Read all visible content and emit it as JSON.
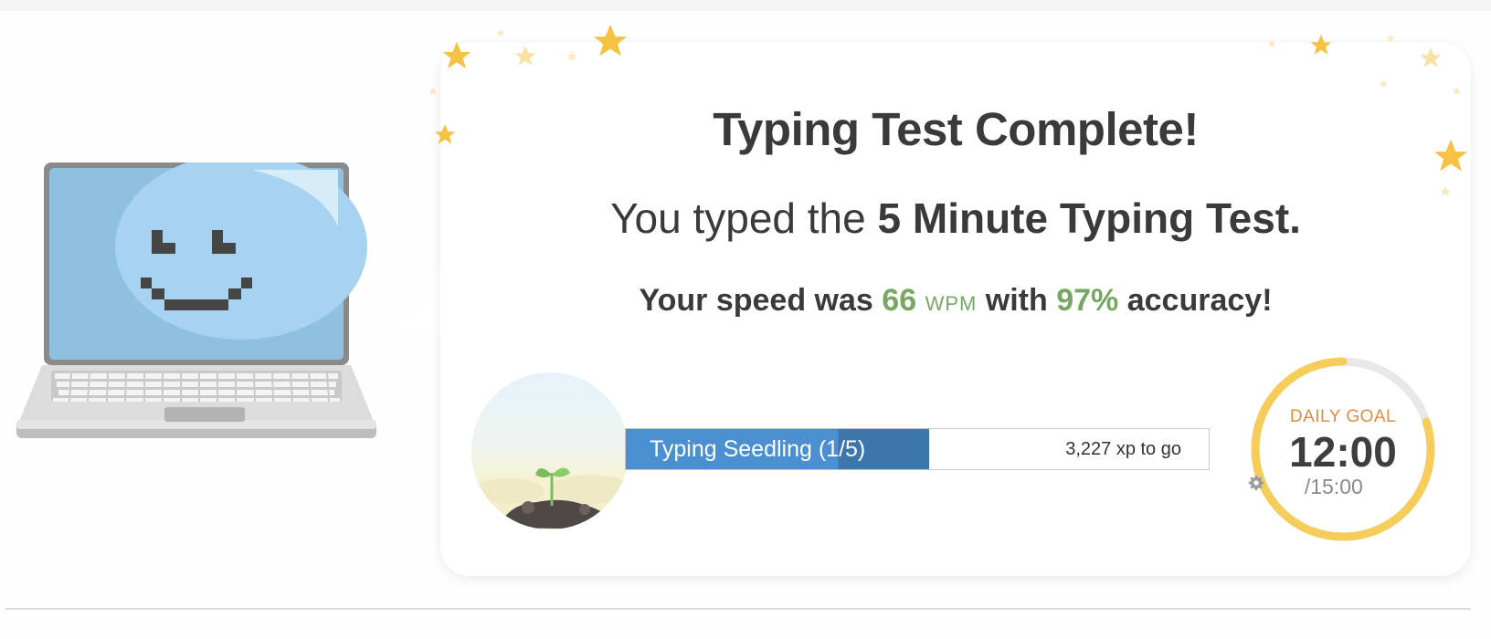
{
  "result": {
    "title": "Typing Test Complete!",
    "subtitle_prefix": "You typed the",
    "test_name": "5 Minute Typing Test.",
    "speed_prefix": "Your speed was",
    "wpm_value": "66",
    "wpm_unit": "WPM",
    "accuracy_prefix": "with",
    "accuracy_value": "97%",
    "accuracy_suffix": "accuracy!"
  },
  "level": {
    "name": "Typing Seedling (1/5)",
    "xp_to_go": "3,227 xp to go",
    "progress_fraction": 0.52
  },
  "daily_goal": {
    "label": "DAILY GOAL",
    "time": "12:00",
    "total": "/15:00",
    "progress_fraction": 0.8
  },
  "colors": {
    "accent_green": "#76a862",
    "progress_blue": "#4a8fd0",
    "goal_ring": "#f6cd5a",
    "goal_label": "#e88a3c"
  },
  "icons": [
    "laptop-smiley-illustration",
    "seedling-illustration",
    "star-icon",
    "gear-icon"
  ]
}
